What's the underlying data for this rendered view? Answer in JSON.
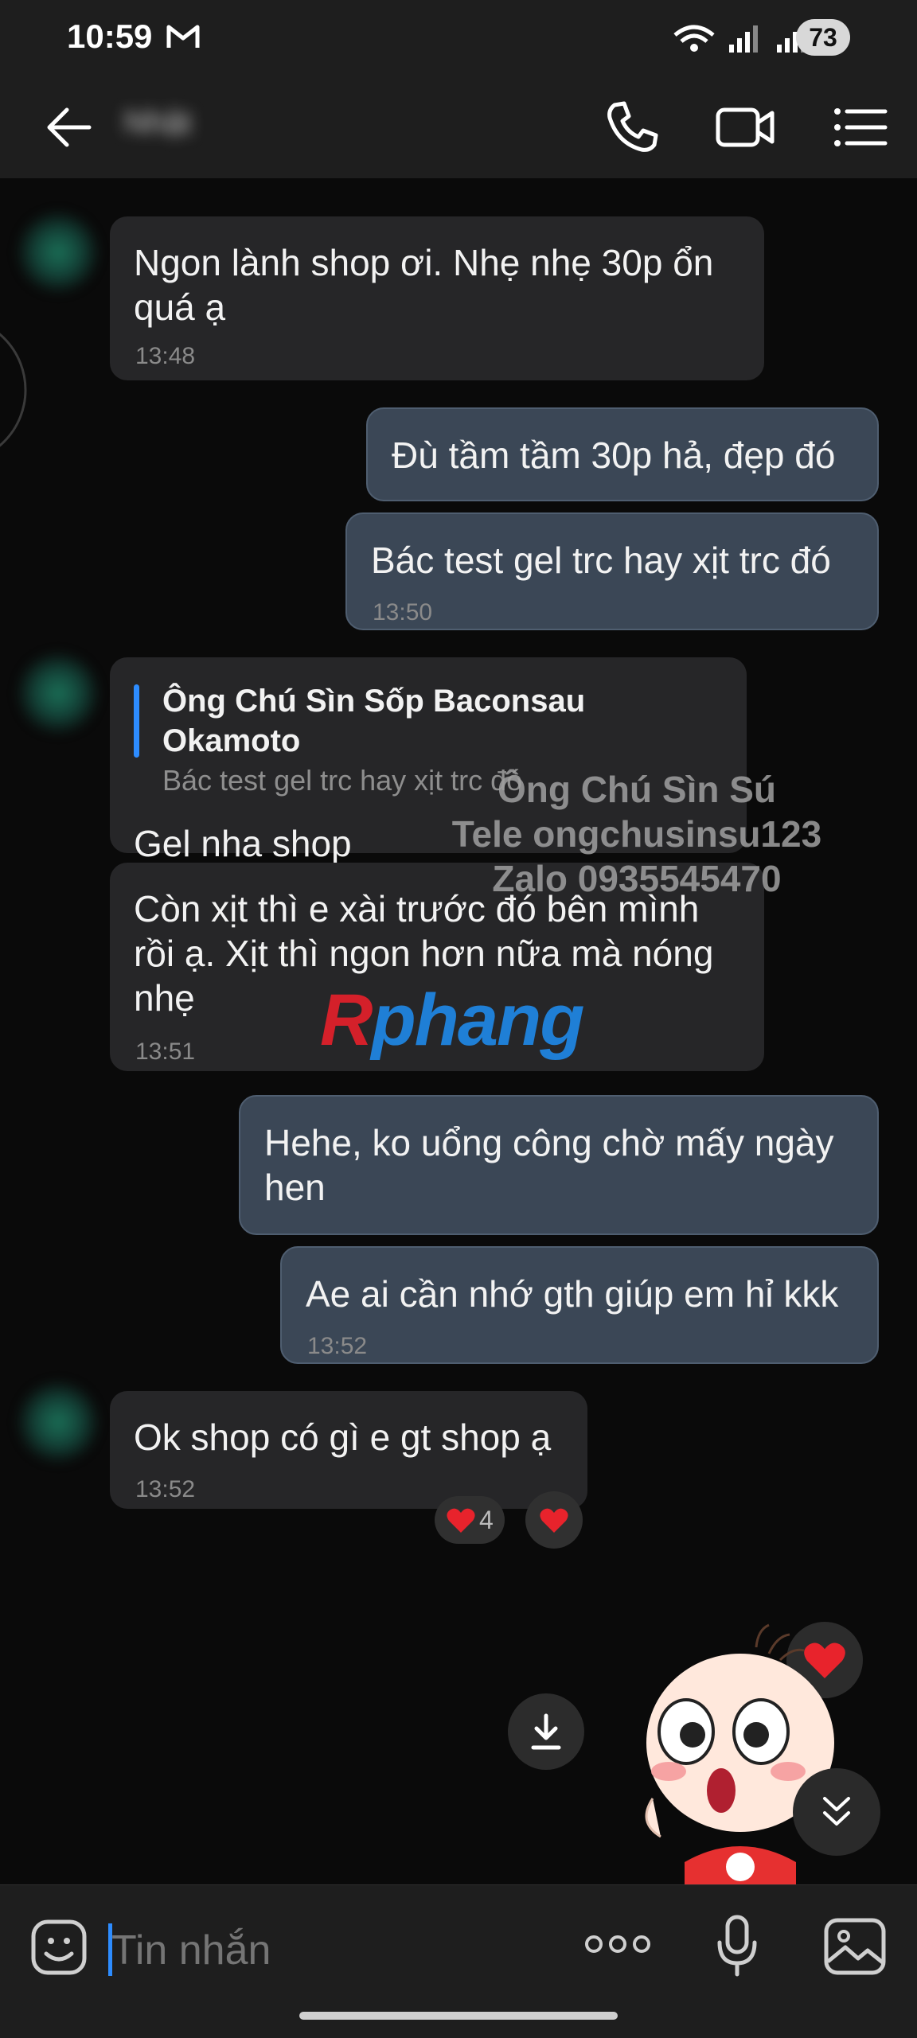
{
  "status_bar": {
    "time": "10:59",
    "battery": "73"
  },
  "header": {
    "contact_name": "Nhật"
  },
  "messages": [
    {
      "side": "in",
      "text": "Ngon lành shop ơi. Nhẹ nhẹ 30p ổn quá ạ",
      "time": "13:48"
    },
    {
      "side": "out",
      "text": "Đù tầm tầm 30p hả, đẹp đó",
      "time": ""
    },
    {
      "side": "out",
      "text": "Bác test gel trc hay xịt trc đó",
      "time": "13:50"
    },
    {
      "side": "in",
      "quote_author": "Ông Chú Sìn Sốp Baconsau Okamoto",
      "quote_text": "Bác test gel trc hay xịt trc đó",
      "text": "Gel nha shop",
      "time": ""
    },
    {
      "side": "in",
      "text": "Còn xịt thì e xài trước đó bên mình rồi ạ. Xịt thì ngon hơn nữa mà nóng nhẹ",
      "time": "13:51"
    },
    {
      "side": "out",
      "text": "Hehe, ko uổng công chờ mấy ngày hen",
      "time": ""
    },
    {
      "side": "out",
      "text": "Ae ai cần nhớ gth giúp em hỉ kkk",
      "time": "13:52"
    },
    {
      "side": "in",
      "text": "Ok shop có gì e gt shop ạ",
      "time": "13:52"
    }
  ],
  "reactions": {
    "count": "4"
  },
  "watermark": {
    "line1": "Ông Chú Sìn Sú",
    "line2": "Tele ongchusinsu123",
    "line3": "Zalo 0935545470"
  },
  "logo": {
    "part1": "R",
    "part2": "phang"
  },
  "composer": {
    "placeholder": "Tin nhắn"
  },
  "colors": {
    "accent": "#2d8cff",
    "outgoing_bubble": "#3b4756",
    "incoming_bubble": "#262628",
    "heart": "#e8232c"
  }
}
